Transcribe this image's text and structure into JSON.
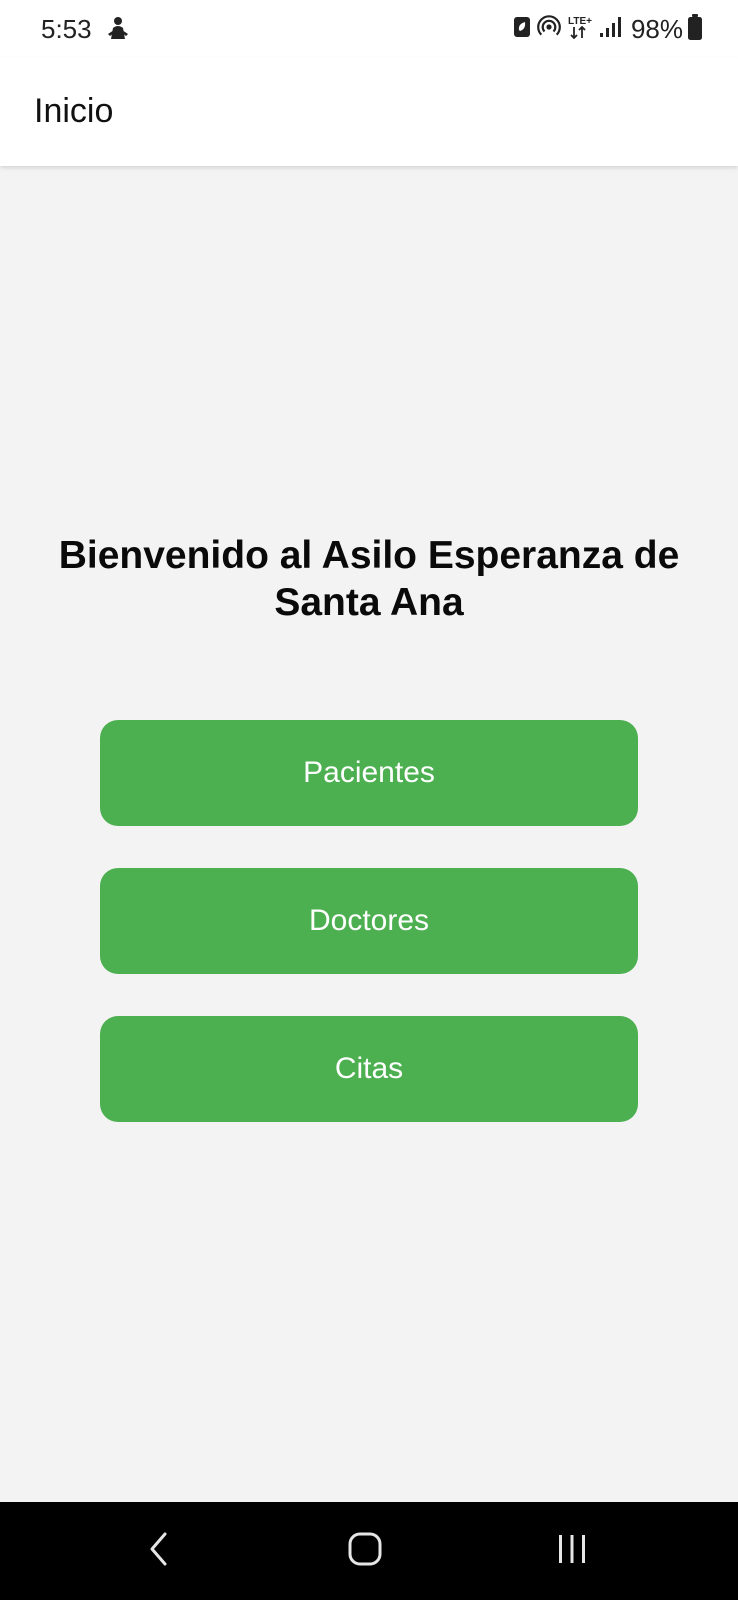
{
  "status_bar": {
    "time": "5:53",
    "battery_percent": "98%",
    "network_label": "LTE+",
    "icons": [
      "notification-icon",
      "battery-saver-icon",
      "hotspot-icon",
      "lte-icon",
      "signal-icon",
      "battery-icon"
    ]
  },
  "app_bar": {
    "title": "Inicio"
  },
  "main": {
    "welcome_text": "Bienvenido al Asilo Esperanza de Santa Ana",
    "buttons": [
      {
        "label": "Pacientes"
      },
      {
        "label": "Doctores"
      },
      {
        "label": "Citas"
      }
    ],
    "accent_color": "#4caf50",
    "background_color": "#f3f3f4"
  },
  "nav_bar": {
    "icons": [
      "back-icon",
      "home-icon",
      "recent-apps-icon"
    ]
  }
}
